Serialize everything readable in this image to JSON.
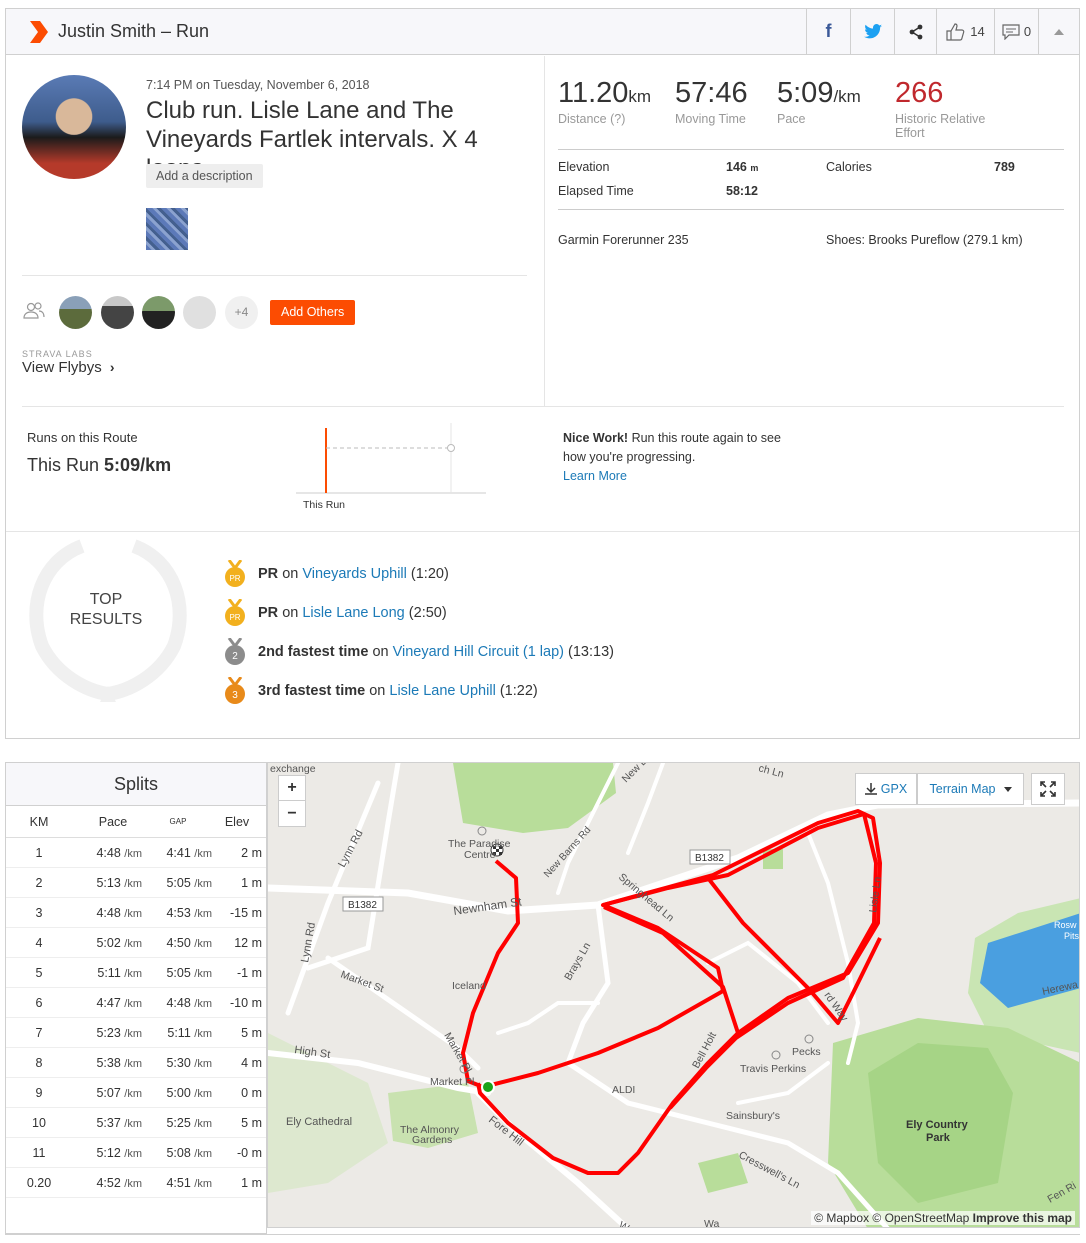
{
  "header": {
    "title": "Justin Smith – Run",
    "kudos_count": "14",
    "comments_count": "0"
  },
  "activity": {
    "datetime": "7:14 PM on Tuesday, November 6, 2018",
    "title": "Club run. Lisle Lane and The Vineyards Fartlek intervals. X 4 loops.",
    "add_description": "Add a description",
    "others_more": "+4",
    "add_others": "Add Others",
    "labs_label": "STRAVA LABS",
    "flybys": "View Flybys"
  },
  "stats": {
    "distance_value": "11.20",
    "distance_unit": "km",
    "distance_label": "Distance (?)",
    "moving_time_value": "57:46",
    "moving_time_label": "Moving Time",
    "pace_value": "5:09",
    "pace_unit": "/km",
    "pace_label": "Pace",
    "effort_value": "266",
    "effort_label": "Historic Relative Effort",
    "elevation_label": "Elevation",
    "elevation_value": "146",
    "elevation_unit": "m",
    "calories_label": "Calories",
    "calories_value": "789",
    "elapsed_label": "Elapsed Time",
    "elapsed_value": "58:12",
    "device": "Garmin Forerunner 235",
    "shoes": "Shoes: Brooks Pureflow (279.1 km)"
  },
  "route": {
    "label": "Runs on this Route",
    "this_run_prefix": "This Run",
    "this_run_value": "5:09/km",
    "chart_label": "This Run",
    "nice_bold": "Nice Work!",
    "nice_text": "Run this route again to see how you're progressing.",
    "learn_more": "Learn More"
  },
  "top_results": {
    "heading": "TOP RESULTS",
    "items": [
      {
        "rank": "PR",
        "achievement": "PR",
        "on": "on",
        "segment": "Vineyards Uphill",
        "time": "(1:20)"
      },
      {
        "rank": "PR",
        "achievement": "PR",
        "on": "on",
        "segment": "Lisle Lane Long",
        "time": "(2:50)"
      },
      {
        "rank": "2",
        "achievement": "2nd fastest time",
        "on": "on",
        "segment": "Vineyard Hill Circuit (1 lap)",
        "time": "(13:13)"
      },
      {
        "rank": "3",
        "achievement": "3rd fastest time",
        "on": "on",
        "segment": "Lisle Lane Uphill",
        "time": "(1:22)"
      }
    ],
    "colors": {
      "pr": "#f2b01e",
      "silver": "#8c8c8c",
      "bronze": "#e88a1a"
    }
  },
  "splits": {
    "title": "Splits",
    "headers": {
      "km": "KM",
      "pace": "Pace",
      "gap": "GAP",
      "elev": "Elev"
    },
    "unit_pace": "/km",
    "unit_elev": "m",
    "rows": [
      {
        "km": "1",
        "pace": "4:48",
        "gap": "4:41",
        "elev": "2"
      },
      {
        "km": "2",
        "pace": "5:13",
        "gap": "5:05",
        "elev": "1"
      },
      {
        "km": "3",
        "pace": "4:48",
        "gap": "4:53",
        "elev": "-15"
      },
      {
        "km": "4",
        "pace": "5:02",
        "gap": "4:50",
        "elev": "12"
      },
      {
        "km": "5",
        "pace": "5:11",
        "gap": "5:05",
        "elev": "-1"
      },
      {
        "km": "6",
        "pace": "4:47",
        "gap": "4:48",
        "elev": "-10"
      },
      {
        "km": "7",
        "pace": "5:23",
        "gap": "5:11",
        "elev": "5"
      },
      {
        "km": "8",
        "pace": "5:38",
        "gap": "5:30",
        "elev": "4"
      },
      {
        "km": "9",
        "pace": "5:07",
        "gap": "5:00",
        "elev": "0"
      },
      {
        "km": "10",
        "pace": "5:37",
        "gap": "5:25",
        "elev": "5"
      },
      {
        "km": "11",
        "pace": "5:12",
        "gap": "5:08",
        "elev": "-0"
      },
      {
        "km": "0.20",
        "pace": "4:52",
        "gap": "4:51",
        "elev": "1"
      }
    ]
  },
  "map": {
    "zoom_in": "+",
    "zoom_out": "−",
    "gpx": "GPX",
    "terrain": "Terrain Map",
    "attribution_1": "© Mapbox © OpenStreetMap",
    "attribution_2": "Improve this map",
    "labels": {
      "exchange": "exchange",
      "new_l": "New L",
      "ch_ln": "ch Ln",
      "lynn_rd_1": "Lynn Rd",
      "lynn_rd_2": "Lynn Rd",
      "paradise": "The Paradise",
      "paradise2": "Centre",
      "new_barns": "New Barns Rd",
      "b1382a": "B1382",
      "b1382b": "B1382",
      "newnham": "Newnham St",
      "springhead": "Springhead Ln",
      "lisle": "Lisle Ln",
      "market_st": "Market St",
      "iceland": "Iceland",
      "brays": "Brays Ln",
      "rosw": "Rosw",
      "pits": "Pits",
      "herewa": "Herewa",
      "ward_way": "rd Way",
      "high_st": "High St",
      "market_pl": "Market Pl",
      "market_pl2": "Market Pl",
      "aldi": "ALDI",
      "bell_holt": "Bell Holt",
      "pecks": "Pecks",
      "travis": "Travis Perkins",
      "ely_cathedral": "Ely Cathedral",
      "almonry": "The Almonry",
      "almonry2": "Gardens",
      "fore_hill": "Fore Hill",
      "sainsburys": "Sainsbury's",
      "cresswells": "Cresswell's Ln",
      "ely_park": "Ely Country",
      "ely_park2": "Park",
      "fen_ri": "Fen Ri",
      "wa": "Wa",
      "w": "W"
    },
    "colors": {
      "route": "#ff0000",
      "water": "#4a9fe0",
      "park": "#b8dd9a",
      "road": "#ffffff"
    }
  }
}
